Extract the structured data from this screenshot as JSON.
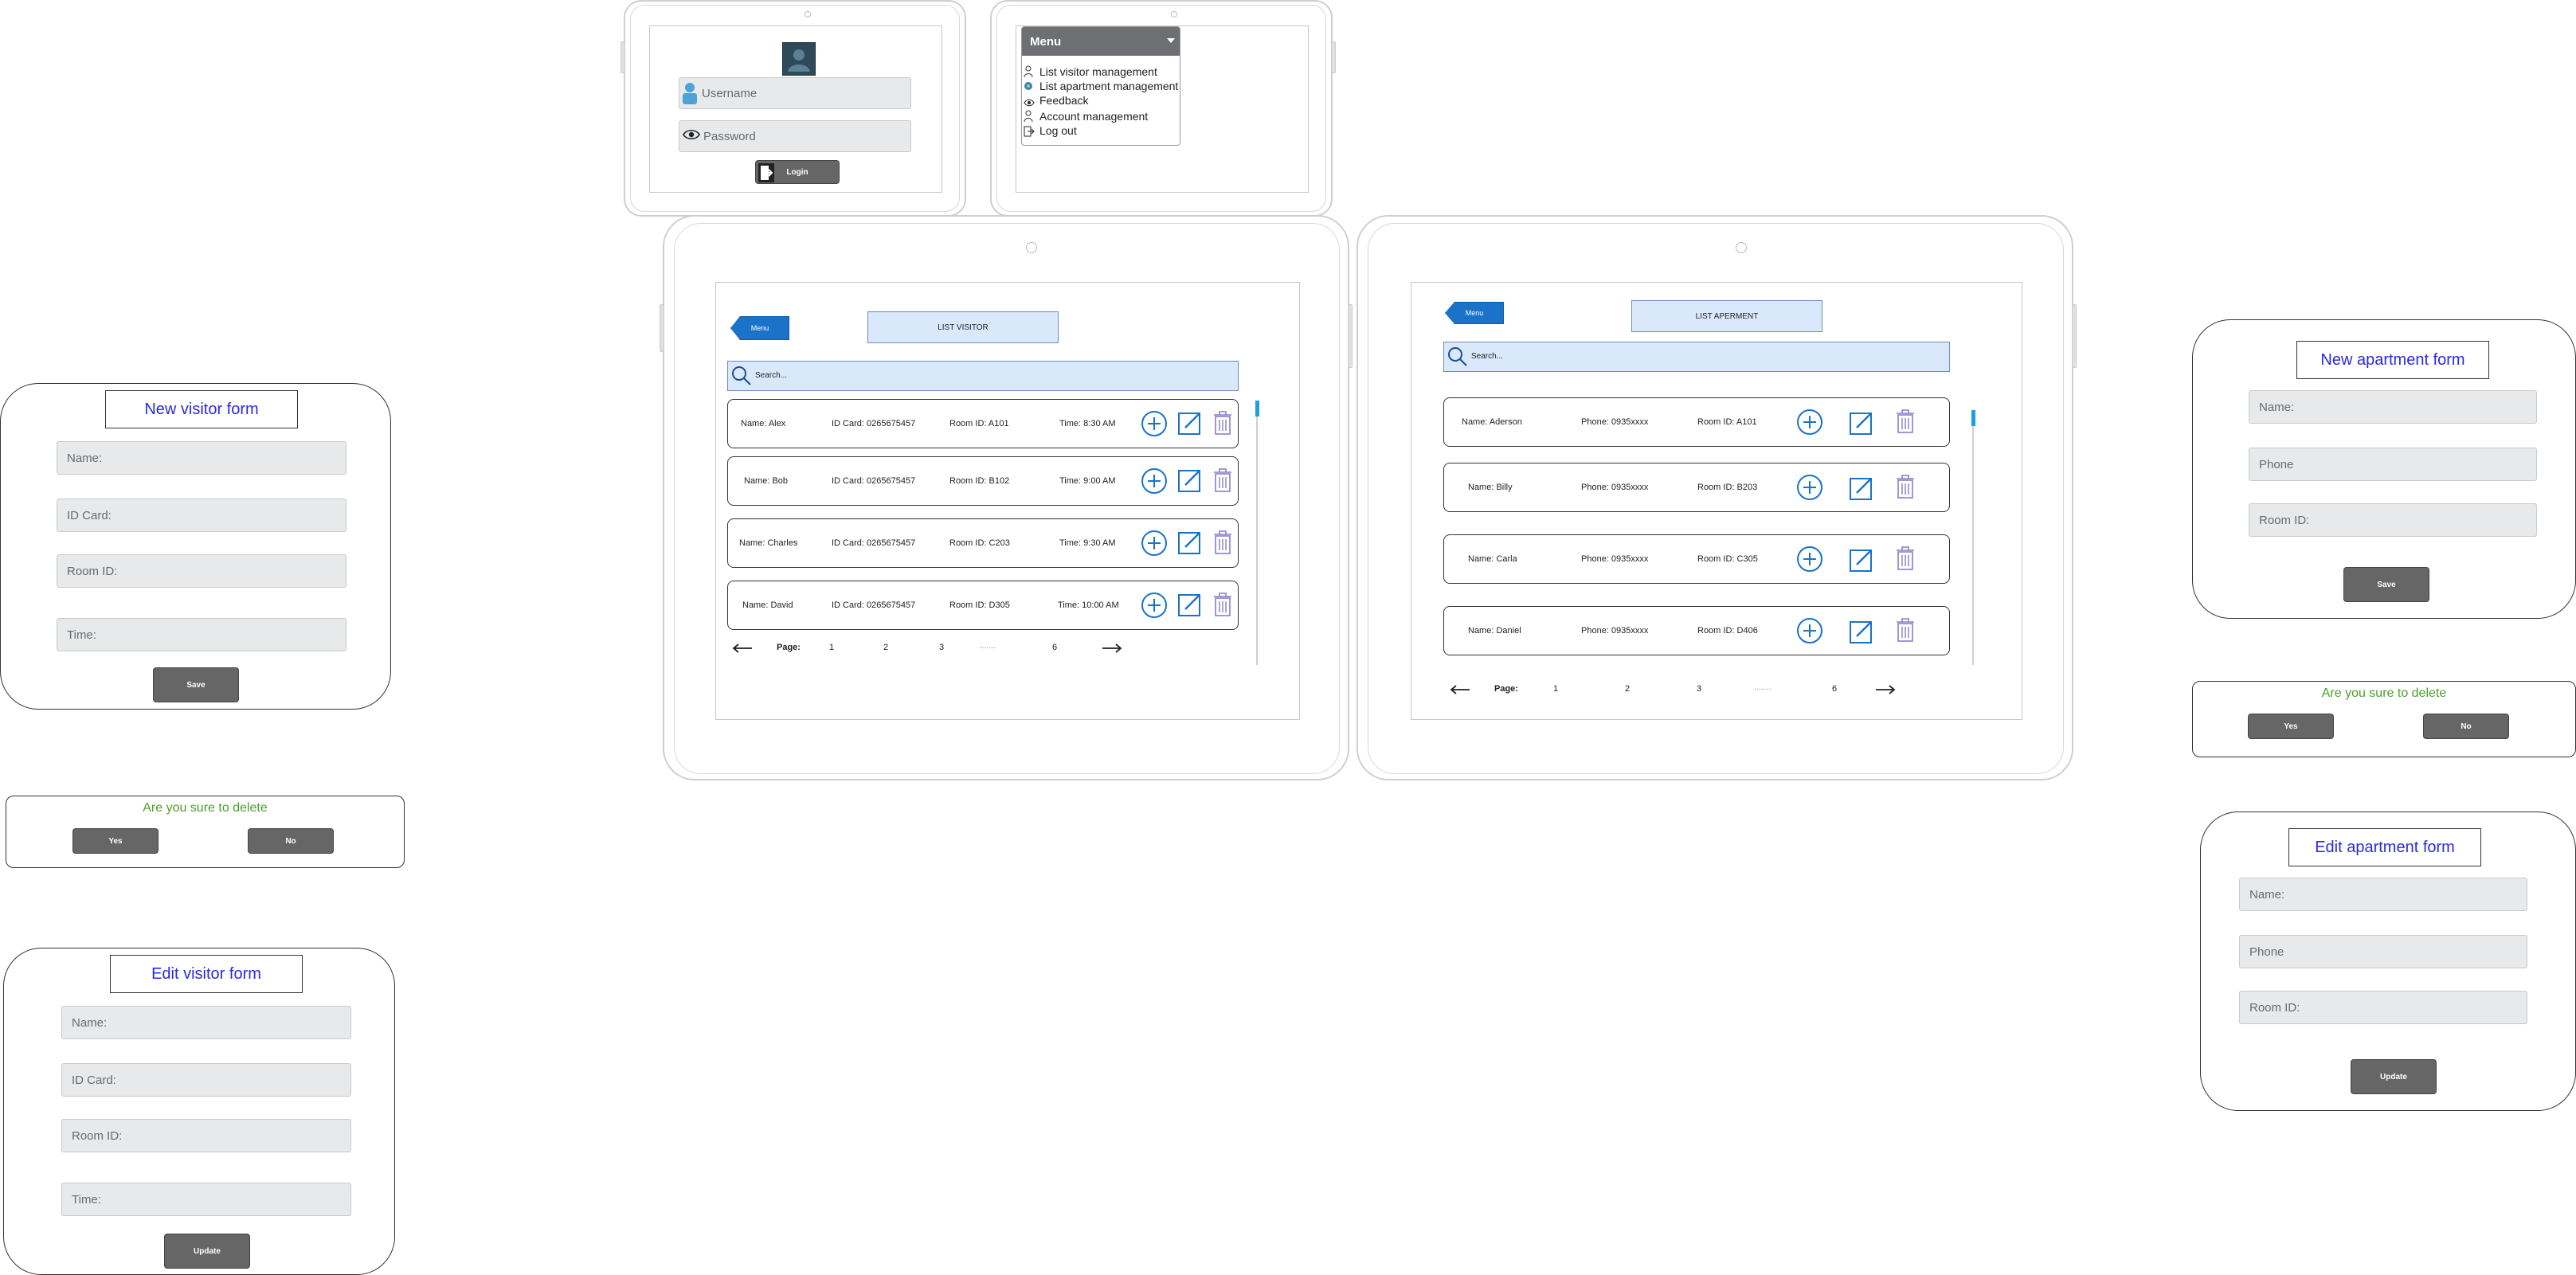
{
  "login": {
    "username_placeholder": "Username",
    "password_placeholder": "Password",
    "login_label": "Login"
  },
  "menu_screen": {
    "header": "Menu",
    "items": [
      "List visitor management",
      "List apartment management",
      "Feedback",
      "Account management",
      "Log out"
    ]
  },
  "visitor_list": {
    "menu_label": "Menu",
    "title": "LIST VISITOR",
    "search_placeholder": "Search...",
    "rows": [
      {
        "name": "Name: Alex",
        "idcard": "ID Card: 0265675457",
        "room": "Room ID: A101",
        "time": "Time: 8:30 AM"
      },
      {
        "name": "Name: Bob",
        "idcard": "ID Card: 0265675457",
        "room": "Room ID: B102",
        "time": "Time: 9:00 AM"
      },
      {
        "name": "Name: Charles",
        "idcard": "ID Card: 0265675457",
        "room": "Room ID: C203",
        "time": "Time: 9:30 AM"
      },
      {
        "name": "Name: David",
        "idcard": "ID Card: 0265675457",
        "room": "Room ID: D305",
        "time": "Time: 10:00 AM"
      }
    ],
    "pager": {
      "label": "Page:",
      "p1": "1",
      "p2": "2",
      "p3": "3",
      "dots": ".......",
      "last": "6"
    }
  },
  "apartment_list": {
    "menu_label": "Menu",
    "title": "LIST APERMENT",
    "search_placeholder": "Search...",
    "rows": [
      {
        "name": "Name: Aderson",
        "phone": "Phone: 0935xxxx",
        "room": "Room ID: A101"
      },
      {
        "name": "Name: Billy",
        "phone": "Phone: 0935xxxx",
        "room": "Room ID: B203"
      },
      {
        "name": "Name: Carla",
        "phone": "Phone: 0935xxxx",
        "room": "Room ID: C305"
      },
      {
        "name": "Name: Daniel",
        "phone": "Phone: 0935xxxx",
        "room": "Room ID: D406"
      }
    ],
    "pager": {
      "label": "Page:",
      "p1": "1",
      "p2": "2",
      "p3": "3",
      "dots": ".......",
      "last": "6"
    }
  },
  "new_visitor_form": {
    "title": "New visitor form",
    "name": "Name:",
    "idcard": "ID Card:",
    "room": "Room ID:",
    "time": "Time:",
    "save": "Save"
  },
  "visitor_delete_confirm": {
    "text": "Are you sure to delete",
    "yes": "Yes",
    "no": "No"
  },
  "edit_visitor_form": {
    "title": "Edit visitor form",
    "name": "Name:",
    "idcard": "ID Card:",
    "room": "Room ID:",
    "time": "Time:",
    "update": "Update"
  },
  "new_apartment_form": {
    "title": "New apartment form",
    "name": "Name:",
    "phone": "Phone",
    "room": "Room ID:",
    "save": "Save"
  },
  "apartment_delete_confirm": {
    "text": "Are you sure to delete",
    "yes": "Yes",
    "no": "No"
  },
  "edit_apartment_form": {
    "title": "Edit apartment form",
    "name": "Name:",
    "phone": "Phone",
    "room": "Room ID:",
    "update": "Update"
  },
  "colors": {
    "accent_blue": "#1a73c9",
    "light_blue_fill": "#dae8fc",
    "title_blue": "#2a2adf",
    "confirm_green": "#4aa12a",
    "trash_purple": "#8a7fc7"
  },
  "icons": [
    "user-icon",
    "eye-icon",
    "login-icon",
    "avatar",
    "search-icon",
    "add-icon",
    "edit-icon",
    "trash-icon",
    "arrow-left-icon",
    "arrow-right-icon",
    "feedback-icon",
    "logout-icon"
  ]
}
